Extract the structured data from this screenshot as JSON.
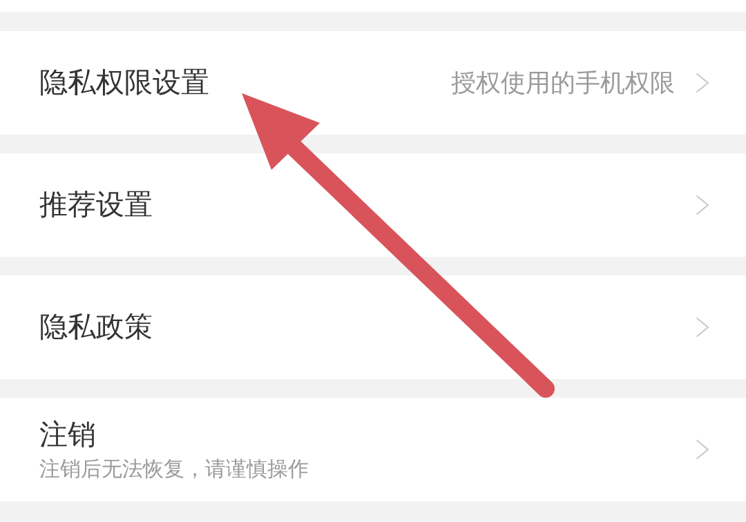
{
  "settings": [
    {
      "title": "隐私权限设置",
      "hint": "授权使用的手机权限"
    },
    {
      "title": "推荐设置"
    },
    {
      "title": "隐私政策"
    },
    {
      "title": "注销",
      "subtitle": "注销后无法恢复，请谨慎操作"
    }
  ]
}
